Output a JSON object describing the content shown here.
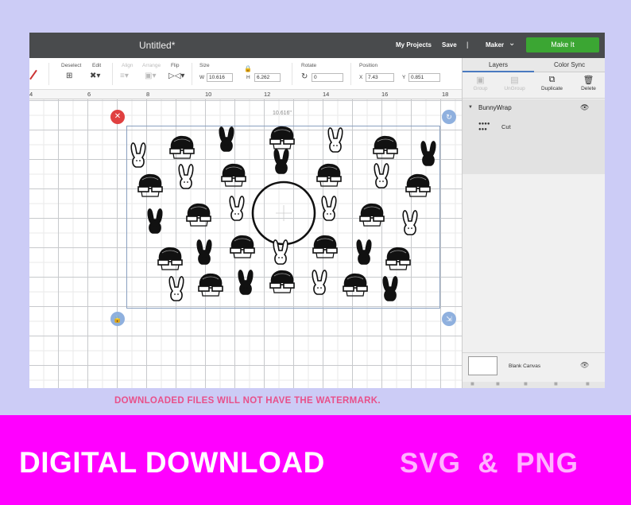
{
  "app": {
    "doc_title": "Untitled*",
    "my_projects": "My Projects",
    "save": "Save",
    "separator": "|",
    "machine": "Maker",
    "make_it": "Make It"
  },
  "toolbar": {
    "deselect": "Deselect",
    "edit": "Edit",
    "align": "Align",
    "arrange": "Arrange",
    "flip": "Flip",
    "size": "Size",
    "w_label": "W",
    "w_value": "10.616",
    "h_label": "H",
    "h_value": "6.262",
    "rotate": "Rotate",
    "rotate_value": "0",
    "position": "Position",
    "x_label": "X",
    "x_value": "7.43",
    "y_label": "Y",
    "y_value": "0.851"
  },
  "ruler": {
    "ticks": [
      "4",
      "6",
      "8",
      "10",
      "12",
      "14",
      "16",
      "18"
    ]
  },
  "canvas": {
    "width_readout": "10.616\""
  },
  "panel": {
    "tab_layers": "Layers",
    "tab_color_sync": "Color Sync",
    "tools": {
      "group": "Group",
      "ungroup": "UnGroup",
      "duplicate": "Duplicate",
      "delete": "Delete"
    },
    "layer_name": "BunnyWrap",
    "layer_op": "Cut",
    "blank_canvas": "Blank Canvas"
  },
  "notice": "DOWNLOADED FILES WILL NOT HAVE THE WATERMARK.",
  "banner": {
    "left": "DIGITAL DOWNLOAD",
    "right": "SVG  &  PNG"
  },
  "colors": {
    "page_bg": "#ccccf6",
    "titlebar": "#494b4d",
    "make_it": "#3ba633",
    "banner": "#ff00ff",
    "banner_right_text": "#ffb3ff",
    "notice": "#e8508a"
  },
  "icons": [
    "pen-icon",
    "lock-icon",
    "rotate-icon",
    "eye-icon",
    "eye-off-icon",
    "delete-handle-icon",
    "scale-handle-icon"
  ]
}
